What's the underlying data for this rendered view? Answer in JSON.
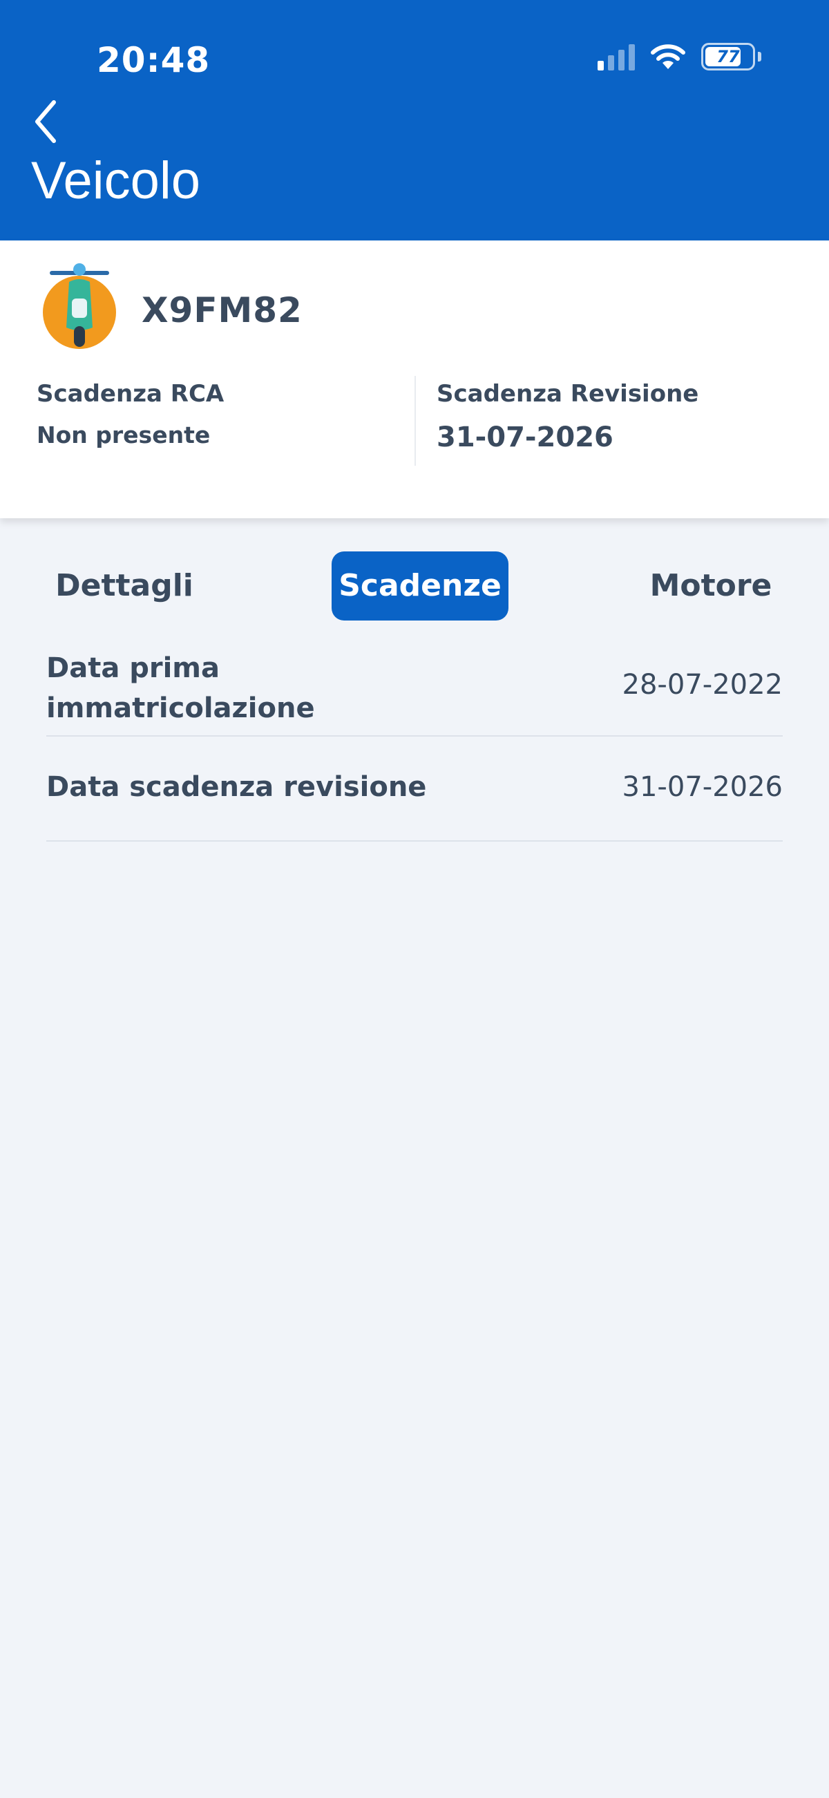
{
  "status_bar": {
    "time": "20:48",
    "battery_level": "77",
    "battery_fraction": 0.77,
    "signal_bars_active": 1,
    "signal_bars_total": 4
  },
  "header": {
    "title": "Veicolo",
    "back_icon": "chevron-left-icon",
    "color": "#0a63c6"
  },
  "vehicle": {
    "icon": "scooter-icon",
    "plate": "X9FM82",
    "rca_label": "Scadenza RCA",
    "rca_value": "Non presente",
    "revision_label": "Scadenza Revisione",
    "revision_value": "31-07-2026"
  },
  "tabs": [
    {
      "label": "Dettagli",
      "active": false
    },
    {
      "label": "Scadenze",
      "active": true
    },
    {
      "label": "Motore",
      "active": false
    }
  ],
  "rows": [
    {
      "label": "Data prima immatricolazione",
      "value": "28-07-2022"
    },
    {
      "label": "Data scadenza revisione",
      "value": "31-07-2026"
    }
  ]
}
